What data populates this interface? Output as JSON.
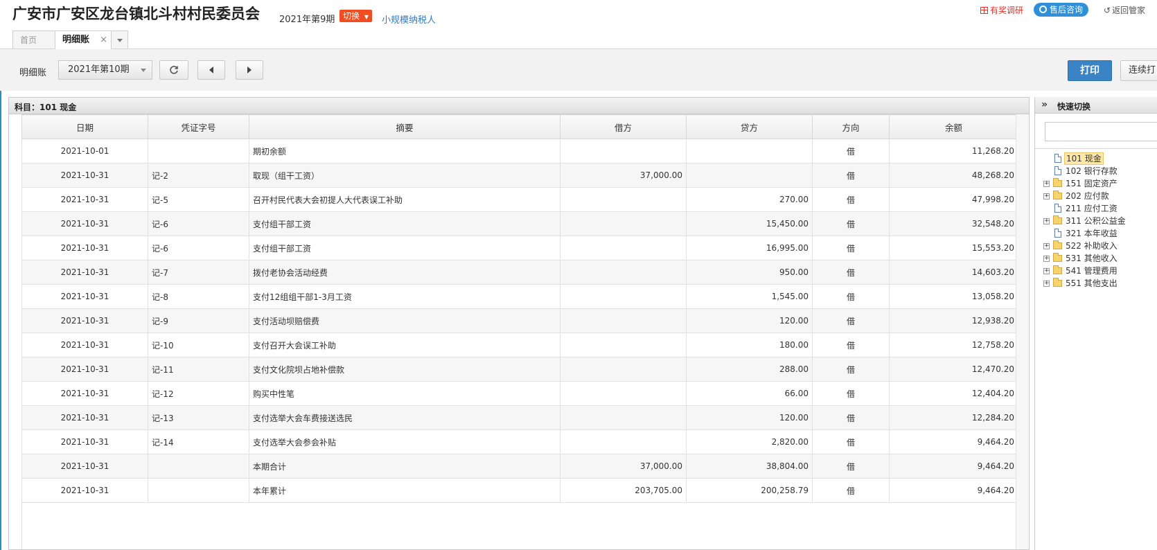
{
  "header": {
    "org_title": "广安市广安区龙台镇北斗村村民委员会",
    "period": "2021年第9期",
    "switch_label": "切换",
    "taxpayer_type": "小规模纳税人",
    "survey_label": "有奖调研",
    "support_label": "售后咨询",
    "back_label": "返回管家"
  },
  "tabs": [
    {
      "label": "首页"
    },
    {
      "label": "明细账",
      "close": "×"
    }
  ],
  "toolbar": {
    "ledger_label": "明细账",
    "period_value": "2021年第10期",
    "print_label": "打印",
    "continuous_print_label": "连续打"
  },
  "grid": {
    "subject": "科目：101  现金",
    "columns": [
      "日期",
      "凭证字号",
      "摘要",
      "借方",
      "贷方",
      "方向",
      "余额"
    ],
    "rows": [
      {
        "date": "2021-10-01",
        "voucher": "",
        "summary": "期初余额",
        "debit": "",
        "credit": "",
        "direction": "借",
        "balance": "11,268.20"
      },
      {
        "date": "2021-10-31",
        "voucher": "记-2",
        "summary": "取现（组干工资）",
        "debit": "37,000.00",
        "credit": "",
        "direction": "借",
        "balance": "48,268.20"
      },
      {
        "date": "2021-10-31",
        "voucher": "记-5",
        "summary": "召开村民代表大会初提人大代表误工补助",
        "debit": "",
        "credit": "270.00",
        "direction": "借",
        "balance": "47,998.20"
      },
      {
        "date": "2021-10-31",
        "voucher": "记-6",
        "summary": "支付组干部工资",
        "debit": "",
        "credit": "15,450.00",
        "direction": "借",
        "balance": "32,548.20"
      },
      {
        "date": "2021-10-31",
        "voucher": "记-6",
        "summary": "支付组干部工资",
        "debit": "",
        "credit": "16,995.00",
        "direction": "借",
        "balance": "15,553.20"
      },
      {
        "date": "2021-10-31",
        "voucher": "记-7",
        "summary": "拨付老协会活动经费",
        "debit": "",
        "credit": "950.00",
        "direction": "借",
        "balance": "14,603.20"
      },
      {
        "date": "2021-10-31",
        "voucher": "记-8",
        "summary": "支付12组组干部1-3月工资",
        "debit": "",
        "credit": "1,545.00",
        "direction": "借",
        "balance": "13,058.20"
      },
      {
        "date": "2021-10-31",
        "voucher": "记-9",
        "summary": "支付活动坝赔偿费",
        "debit": "",
        "credit": "120.00",
        "direction": "借",
        "balance": "12,938.20"
      },
      {
        "date": "2021-10-31",
        "voucher": "记-10",
        "summary": "支付召开大会误工补助",
        "debit": "",
        "credit": "180.00",
        "direction": "借",
        "balance": "12,758.20"
      },
      {
        "date": "2021-10-31",
        "voucher": "记-11",
        "summary": "支付文化院坝占地补偿款",
        "debit": "",
        "credit": "288.00",
        "direction": "借",
        "balance": "12,470.20"
      },
      {
        "date": "2021-10-31",
        "voucher": "记-12",
        "summary": "购买中性笔",
        "debit": "",
        "credit": "66.00",
        "direction": "借",
        "balance": "12,404.20"
      },
      {
        "date": "2021-10-31",
        "voucher": "记-13",
        "summary": "支付选举大会车费接送选民",
        "debit": "",
        "credit": "120.00",
        "direction": "借",
        "balance": "12,284.20"
      },
      {
        "date": "2021-10-31",
        "voucher": "记-14",
        "summary": "支付选举大会参会补贴",
        "debit": "",
        "credit": "2,820.00",
        "direction": "借",
        "balance": "9,464.20"
      },
      {
        "date": "2021-10-31",
        "voucher": "",
        "summary": "本期合计",
        "debit": "37,000.00",
        "credit": "38,804.00",
        "direction": "借",
        "balance": "9,464.20"
      },
      {
        "date": "2021-10-31",
        "voucher": "",
        "summary": "本年累计",
        "debit": "203,705.00",
        "credit": "200,258.79",
        "direction": "借",
        "balance": "9,464.20"
      }
    ]
  },
  "quick_switch": {
    "title": "快速切换",
    "arrows": "»",
    "accounts": [
      {
        "code": "101",
        "name": "现金",
        "type": "file",
        "expandable": false,
        "selected": true
      },
      {
        "code": "102",
        "name": "银行存款",
        "type": "file",
        "expandable": false
      },
      {
        "code": "151",
        "name": "固定资产",
        "type": "folder",
        "expandable": true
      },
      {
        "code": "202",
        "name": "应付款",
        "type": "folder",
        "expandable": true
      },
      {
        "code": "211",
        "name": "应付工资",
        "type": "file",
        "expandable": false
      },
      {
        "code": "311",
        "name": "公积公益金",
        "type": "folder",
        "expandable": true
      },
      {
        "code": "321",
        "name": "本年收益",
        "type": "file",
        "expandable": false
      },
      {
        "code": "522",
        "name": "补助收入",
        "type": "folder",
        "expandable": true
      },
      {
        "code": "531",
        "name": "其他收入",
        "type": "folder",
        "expandable": true
      },
      {
        "code": "541",
        "name": "管理费用",
        "type": "folder",
        "expandable": true
      },
      {
        "code": "551",
        "name": "其他支出",
        "type": "folder",
        "expandable": true
      }
    ]
  },
  "icons": {
    "gift": "gift-icon",
    "headset": "headset-icon",
    "back": "return-icon",
    "refresh": "refresh-icon",
    "prev": "prev-arrow-icon",
    "next": "next-arrow-icon"
  },
  "colors": {
    "switch_bg": "#ee4e22",
    "link": "#2f7cc1",
    "print_bg": "#3a83c4",
    "survey": "#e0322b",
    "support_bg": "#2f8fd8"
  }
}
